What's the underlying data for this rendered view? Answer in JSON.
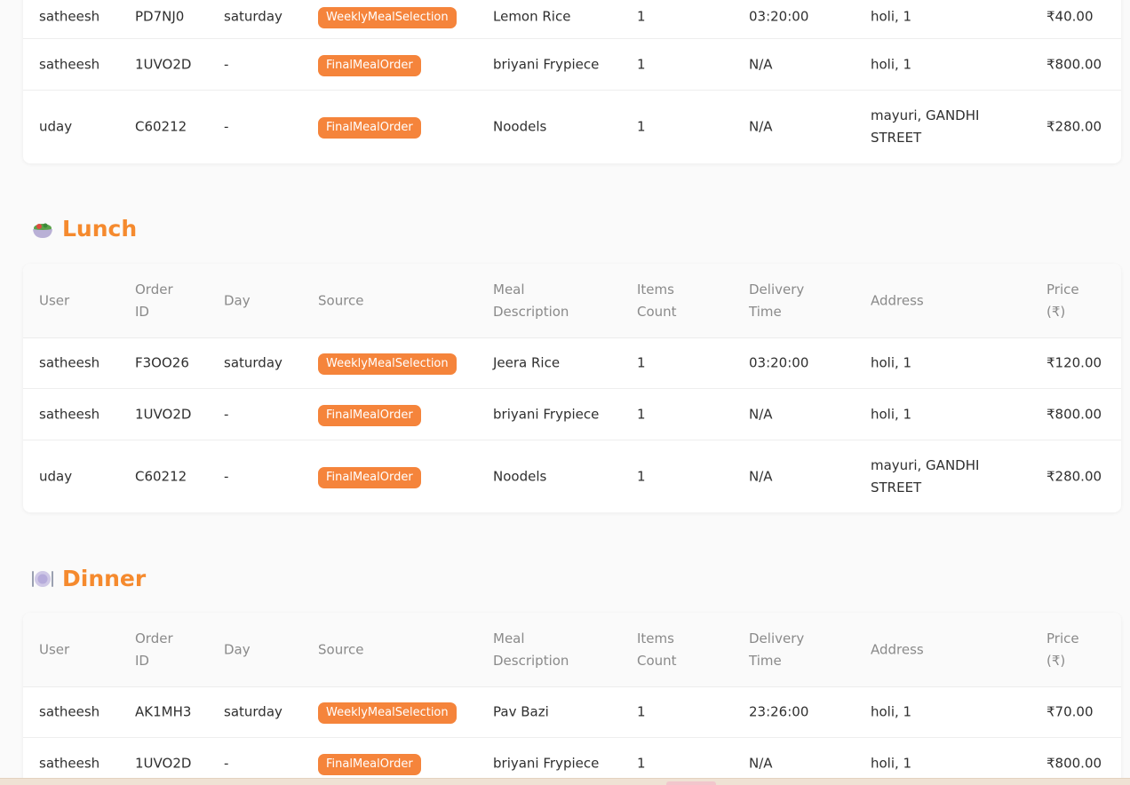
{
  "sections": {
    "top": {
      "rows": [
        {
          "user": "satheesh",
          "order_id": "PD7NJ0",
          "day": "saturday",
          "source": "WeeklyMealSelection",
          "meal": "Lemon Rice",
          "items": "1",
          "time": "03:20:00",
          "address": "holi, 1",
          "price": "₹40.00"
        },
        {
          "user": "satheesh",
          "order_id": "1UVO2D",
          "day": "-",
          "source": "FinalMealOrder",
          "meal": "briyani Frypiece",
          "items": "1",
          "time": "N/A",
          "address": "holi, 1",
          "price": "₹800.00"
        },
        {
          "user": "uday",
          "order_id": "C60212",
          "day": "-",
          "source": "FinalMealOrder",
          "meal": "Noodels",
          "items": "1",
          "time": "N/A",
          "address": "mayuri, GANDHI STREET",
          "price": "₹280.00"
        }
      ]
    },
    "lunch": {
      "title": "Lunch",
      "icon": "salad-bowl-icon",
      "rows": [
        {
          "user": "satheesh",
          "order_id": "F3OO26",
          "day": "saturday",
          "source": "WeeklyMealSelection",
          "meal": "Jeera Rice",
          "items": "1",
          "time": "03:20:00",
          "address": "holi, 1",
          "price": "₹120.00"
        },
        {
          "user": "satheesh",
          "order_id": "1UVO2D",
          "day": "-",
          "source": "FinalMealOrder",
          "meal": "briyani Frypiece",
          "items": "1",
          "time": "N/A",
          "address": "holi, 1",
          "price": "₹800.00"
        },
        {
          "user": "uday",
          "order_id": "C60212",
          "day": "-",
          "source": "FinalMealOrder",
          "meal": "Noodels",
          "items": "1",
          "time": "N/A",
          "address": "mayuri, GANDHI STREET",
          "price": "₹280.00"
        }
      ]
    },
    "dinner": {
      "title": "Dinner",
      "icon": "plate-with-cutlery-icon",
      "rows": [
        {
          "user": "satheesh",
          "order_id": "AK1MH3",
          "day": "saturday",
          "source": "WeeklyMealSelection",
          "meal": "Pav Bazi",
          "items": "1",
          "time": "23:26:00",
          "address": "holi, 1",
          "price": "₹70.00"
        },
        {
          "user": "satheesh",
          "order_id": "1UVO2D",
          "day": "-",
          "source": "FinalMealOrder",
          "meal": "briyani Frypiece",
          "items": "1",
          "time": "N/A",
          "address": "holi, 1",
          "price": "₹800.00"
        }
      ]
    }
  },
  "columns": {
    "user": "User",
    "order_id": "Order\nID",
    "day": "Day",
    "source": "Source",
    "meal": "Meal\nDescription",
    "items": "Items\nCount",
    "time": "Delivery\nTime",
    "address": "Address",
    "price": "Price\n(₹)"
  },
  "colors": {
    "accent": "#f58a2e",
    "badge": "#f5843b",
    "page_bg": "#fafafa"
  }
}
